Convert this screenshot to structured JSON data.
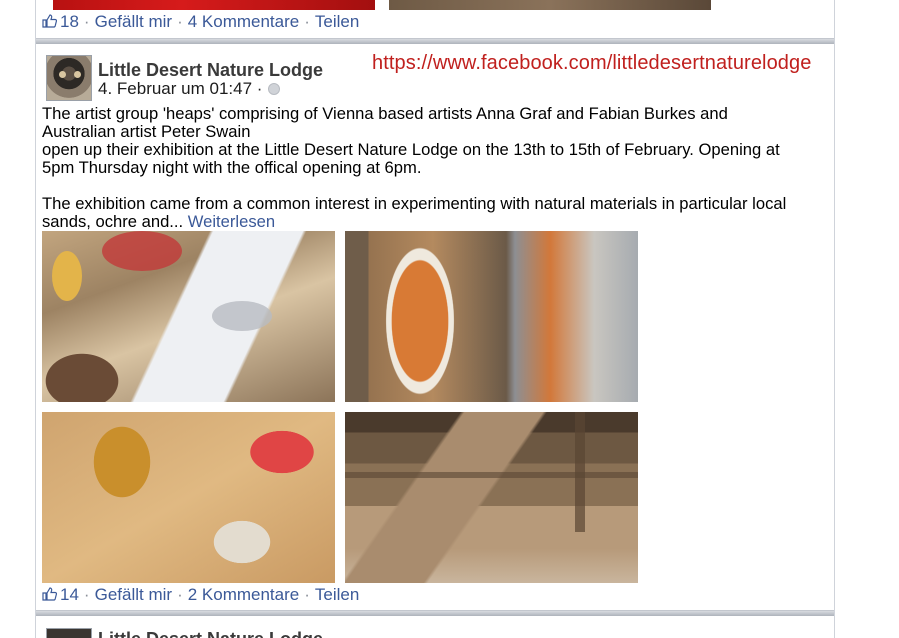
{
  "prev_post": {
    "likes": "18",
    "like_label": "Gefällt mir",
    "comments_label": "4 Kommentare",
    "share_label": "Teilen"
  },
  "post": {
    "author": "Little Desert Nature Lodge",
    "timestamp": "4. Februar um 01:47 ·",
    "overlay_url": "https://www.facebook.com/littledesertnaturelodge",
    "text_line1": "The artist group 'heaps' comprising of Vienna based artists Anna Graf and Fabian Burkes and",
    "text_line2": "Australian artist Peter Swain",
    "text_line3": "open up their exhibition at the Little Desert Nature Lodge on the 13th to 15th of February. Opening at",
    "text_line4": "5pm Thursday night with the offical opening at 6pm.",
    "text_para2": "The exhibition came from a common interest in experimenting with natural materials in particular local sands, ochre and...",
    "read_more": "Weiterlesen",
    "likes": "14",
    "like_label": "Gefällt mir",
    "comments_label": "2 Kommentare",
    "share_label": "Teilen"
  },
  "next_post": {
    "author": "Little Desert Nature Lodge"
  },
  "colors": {
    "link": "#3b5998",
    "url_overlay": "#c0201e"
  }
}
